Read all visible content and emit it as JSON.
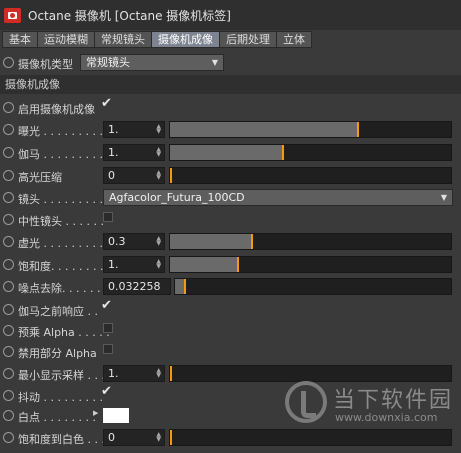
{
  "window": {
    "title": "Octane 摄像机 [Octane 摄像机标签]",
    "icon": "camera-icon",
    "accent": "#cf2d22"
  },
  "tabs": [
    {
      "label": "基本",
      "active": false
    },
    {
      "label": "运动模糊",
      "active": false
    },
    {
      "label": "常规镜头",
      "active": false
    },
    {
      "label": "摄像机成像",
      "active": true
    },
    {
      "label": "后期处理",
      "active": false
    },
    {
      "label": "立体",
      "active": false
    }
  ],
  "camera_type": {
    "label": "摄像机类型",
    "value": "常规镜头"
  },
  "section_title": "摄像机成像",
  "fields": {
    "enable_imager": {
      "label": "启用摄像机成像",
      "checked": true
    },
    "exposure": {
      "label": "曝光 . . . . . . . . .",
      "value": "1.",
      "slider_fraction": 0.67
    },
    "gamma": {
      "label": "伽马 . . . . . . . . .",
      "value": "1.",
      "slider_fraction": 0.4
    },
    "highlight_compression": {
      "label": "高光压缩",
      "value": "0",
      "slider_fraction": 0.0
    },
    "lens": {
      "label": "镜头 . . . . . . . . .",
      "value": "Agfacolor_Futura_100CD"
    },
    "neutral_response": {
      "label": "中性镜头 . . . . . .",
      "checked": false
    },
    "vignetting": {
      "label": "虚光 . . . . . . . . .",
      "value": "0.3",
      "slider_fraction": 0.29
    },
    "saturation": {
      "label": "饱和度. . . . . . . .",
      "value": "1.",
      "slider_fraction": 0.24
    },
    "hot_pixel_removal": {
      "label": "噪点去除. . . . . . .",
      "value": "0.032258",
      "slider_fraction": 0.032
    },
    "gamma_before_response": {
      "label": "伽马之前响应 . .",
      "checked": true
    },
    "premultiplied_alpha": {
      "label": "预乘 Alpha . . . . .",
      "checked": false
    },
    "disable_partial_alpha": {
      "label": "禁用部分 Alpha",
      "checked": false
    },
    "min_display_samples": {
      "label": "最小显示采样 . . .",
      "value": "1.",
      "slider_fraction": 0.0
    },
    "dithering": {
      "label": "抖动 . . . . . . . . .",
      "checked": true
    },
    "white_point": {
      "label": "白点 . . . . . . . .",
      "color": "#ffffff"
    },
    "saturate_to_white": {
      "label": "饱和度到白色 . . .",
      "value": "0",
      "slider_fraction": 0.0
    }
  },
  "watermark": {
    "text": "当下软件园",
    "url": "www.downxia.com"
  }
}
